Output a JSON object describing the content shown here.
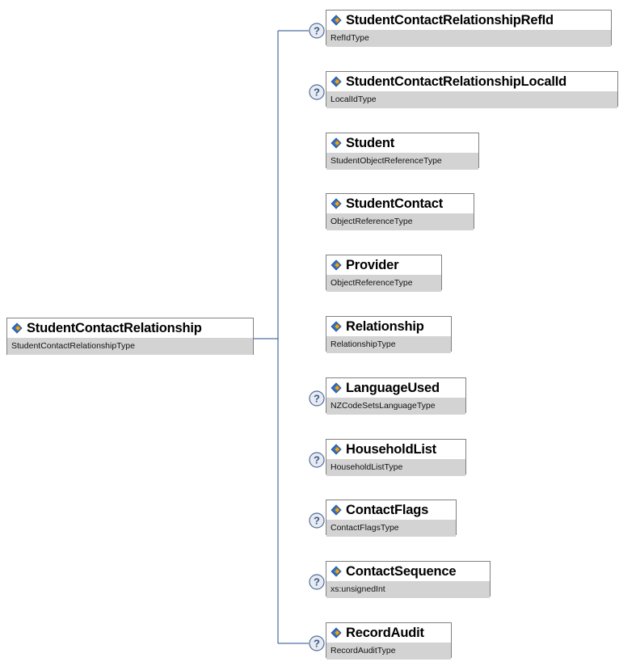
{
  "diagram": {
    "root": {
      "name": "StudentContactRelationship",
      "type": "StudentContactRelationshipType"
    },
    "children": [
      {
        "name": "StudentContactRelationshipRefId",
        "type": "RefIdType",
        "optional": true
      },
      {
        "name": "StudentContactRelationshipLocalId",
        "type": "LocalIdType",
        "optional": true
      },
      {
        "name": "Student",
        "type": "StudentObjectReferenceType",
        "optional": false
      },
      {
        "name": "StudentContact",
        "type": "ObjectReferenceType",
        "optional": false
      },
      {
        "name": "Provider",
        "type": "ObjectReferenceType",
        "optional": false
      },
      {
        "name": "Relationship",
        "type": "RelationshipType",
        "optional": false
      },
      {
        "name": "LanguageUsed",
        "type": "NZCodeSetsLanguageType",
        "optional": true
      },
      {
        "name": "HouseholdList",
        "type": "HouseholdListType",
        "optional": true
      },
      {
        "name": "ContactFlags",
        "type": "ContactFlagsType",
        "optional": true
      },
      {
        "name": "ContactSequence",
        "type": "xs:unsignedInt",
        "optional": true
      },
      {
        "name": "RecordAudit",
        "type": "RecordAuditType",
        "optional": true
      }
    ],
    "optional_marker_glyph": "?",
    "icons": {
      "element": "element-diamond-icon",
      "optional": "optional-question-icon"
    },
    "colors": {
      "type_band": "#d3d3d3",
      "node_border": "#808080",
      "connector": "#1f4e8c",
      "marker_fill": "#e8ecf2",
      "marker_stroke": "#4f6e9a",
      "marker_glyph": "#3a5a85",
      "icon_blue": "#2c6fcb",
      "icon_gold": "#f0a818"
    }
  }
}
